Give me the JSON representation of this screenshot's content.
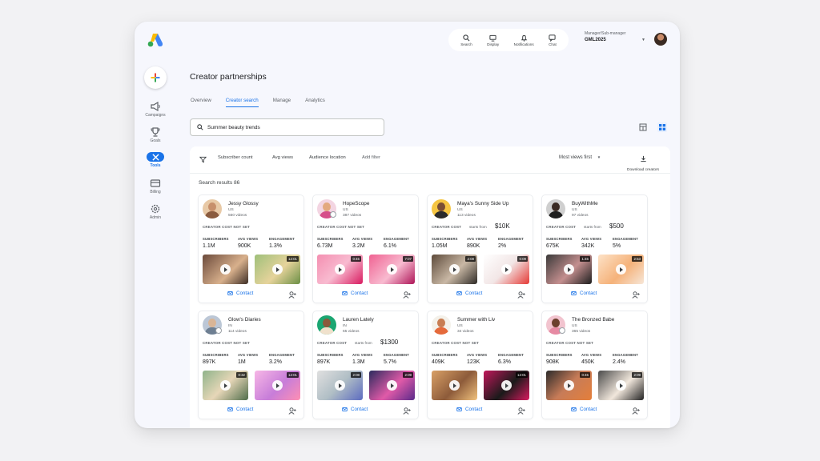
{
  "nav": {
    "items": [
      {
        "label": "Campaigns",
        "icon": "megaphone-icon"
      },
      {
        "label": "Goals",
        "icon": "trophy-icon"
      },
      {
        "label": "Tools",
        "icon": "tools-icon",
        "active": true
      },
      {
        "label": "Billing",
        "icon": "credit-card-icon"
      },
      {
        "label": "Admin",
        "icon": "gear-icon"
      }
    ]
  },
  "topbar": {
    "actions": [
      {
        "label": "Search",
        "icon": "search-icon"
      },
      {
        "label": "Display",
        "icon": "display-icon"
      },
      {
        "label": "Notifications",
        "icon": "bell-icon"
      },
      {
        "label": "Chat",
        "icon": "chat-icon"
      }
    ],
    "account_role": "Manager/Sub-manager",
    "account_name": "GML2025"
  },
  "page": {
    "title": "Creator partnerships",
    "tabs": [
      "Overview",
      "Creator search",
      "Manage",
      "Analytics"
    ],
    "active_tab": 1
  },
  "search": {
    "value": "Summer beauty trends",
    "placeholder": ""
  },
  "filters": {
    "chips": [
      "Subscriber count",
      "Avg views",
      "Audience location"
    ],
    "add_filter": "Add filter",
    "sort": "Most views first",
    "download": "Download creators"
  },
  "results_label": "Search results 86",
  "stat_labels": {
    "subscribers": "SUBSCRIBERS",
    "avg_views": "AVG VIEWS",
    "engagement": "ENGAGEMENT"
  },
  "cost_not_set": "CREATOR COST NOT SET",
  "cost_label": "CREATOR COST",
  "starts_from": "starts from",
  "contact_label": "Contact",
  "creators": [
    {
      "name": "Jessy Glossy",
      "country": "US",
      "videos": "560 videos",
      "cost": null,
      "subscribers": "1.1M",
      "avg_views": "900K",
      "engagement": "1.3%",
      "durations": [
        "",
        "12:01"
      ],
      "verified": false
    },
    {
      "name": "HopeScope",
      "country": "US",
      "videos": "387 videos",
      "cost": null,
      "subscribers": "6.73M",
      "avg_views": "3.2M",
      "engagement": "6.1%",
      "durations": [
        "0:45",
        "7:07"
      ],
      "verified": true
    },
    {
      "name": "Maya's Sunny Side Up",
      "country": "US",
      "videos": "113 videos",
      "cost": "$10K",
      "subscribers": "1.05M",
      "avg_views": "890K",
      "engagement": "2%",
      "durations": [
        "2:08",
        "0:09"
      ],
      "verified": false
    },
    {
      "name": "BuyWithMe",
      "country": "US",
      "videos": "97 videos",
      "cost": "$500",
      "subscribers": "675K",
      "avg_views": "342K",
      "engagement": "5%",
      "durations": [
        "1:45",
        "2:53"
      ],
      "verified": false
    },
    {
      "name": "Glow's Diaries",
      "country": "IN",
      "videos": "114 videos",
      "cost": null,
      "subscribers": "897K",
      "avg_views": "1M",
      "engagement": "3.2%",
      "durations": [
        "0:32",
        "12:01"
      ],
      "verified": true
    },
    {
      "name": "Lauren Lately",
      "country": "IN",
      "videos": "65 videos",
      "cost": "$1300",
      "subscribers": "897K",
      "avg_views": "1.3M",
      "engagement": "5.7%",
      "durations": [
        "2:08",
        "2:09"
      ],
      "verified": false
    },
    {
      "name": "Summer with Liv",
      "country": "US",
      "videos": "34 videos",
      "cost": null,
      "subscribers": "409K",
      "avg_views": "123K",
      "engagement": "6.3%",
      "durations": [
        "",
        "12:01"
      ],
      "verified": false
    },
    {
      "name": "The Bronzed Babe",
      "country": "US",
      "videos": "365 videos",
      "cost": null,
      "subscribers": "908K",
      "avg_views": "450K",
      "engagement": "2.4%",
      "durations": [
        "0:45",
        "2:09"
      ],
      "verified": true
    }
  ],
  "colors": {
    "accent": "#1a73e8",
    "background": "#f6f7fd"
  }
}
